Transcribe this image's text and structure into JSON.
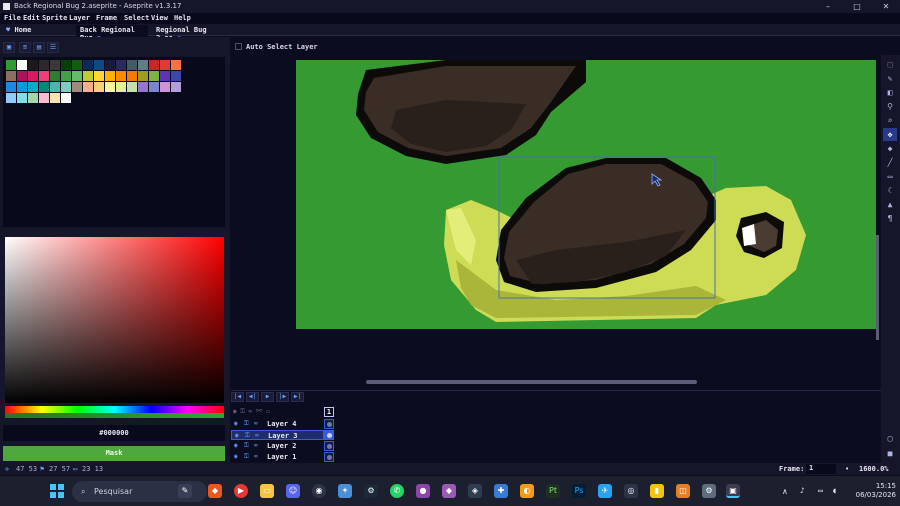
{
  "window": {
    "title": "Back Regional Bug 2.aseprite - Aseprite v1.3.17",
    "controls": [
      "–",
      "□",
      "✕"
    ]
  },
  "menu": [
    "File",
    "Edit",
    "Sprite",
    "Layer",
    "Frame",
    "Select",
    "View",
    "Help"
  ],
  "tabs": [
    {
      "label": "Home",
      "icon": "heart-icon"
    },
    {
      "label": "Back Regional Bug",
      "icon": "dot-icon"
    },
    {
      "label": "Regional Bug 2.as",
      "icon": "dot-outline-icon"
    }
  ],
  "editor": {
    "auto_select_label": "Auto Select Layer",
    "canvas_bg": "#359a31"
  },
  "palette": {
    "colors": [
      "#2e9b2e",
      "#ffffff",
      "#1a1a1a",
      "#2a2a2a",
      "#3a3a3a",
      "#0d3d0d",
      "#155a15",
      "#0b2a5a",
      "#0e4a8a",
      "#1a1a40",
      "#2a2a60",
      "#455a64",
      "#607d8b",
      "#c62828",
      "#e53935",
      "#ff7043",
      "#8d6e63",
      "#ad1457",
      "#d81b60",
      "#ec407a",
      "#2e7d32",
      "#43a047",
      "#66bb6a",
      "#c0ca33",
      "#fdd835",
      "#ffb300",
      "#fb8c00",
      "#f57c00",
      "#9e9d24",
      "#7cb342",
      "#5e35b1",
      "#3949ab",
      "#1e88e5",
      "#039be5",
      "#00acc1",
      "#00897b",
      "#4db6ac",
      "#80cbc4",
      "#a1887f",
      "#ffab91",
      "#ffcc80",
      "#fff59d",
      "#e6ee9c",
      "#c5e1a5",
      "#9575cd",
      "#7986cb",
      "#ce93d8",
      "#b39ddb",
      "#90caf9",
      "#80deea",
      "#a5d6a7",
      "#f8bbd0",
      "#ffe0b2",
      "#ffffff"
    ],
    "hex_value": "#000000",
    "mask_label": "Mask"
  },
  "timeline": {
    "layers": [
      {
        "name": "Layer 4"
      },
      {
        "name": "Layer 3",
        "selected": true
      },
      {
        "name": "Layer 2"
      },
      {
        "name": "Layer 1"
      }
    ],
    "frame_header": "1"
  },
  "statusbar": {
    "cursor": "47 53",
    "flag": "27 57",
    "size": "23 13",
    "frame_label": "Frame:",
    "frame_value": "1",
    "zoom": "1600.0%"
  },
  "taskbar": {
    "search_placeholder": "Pesquisar",
    "time": "15:15",
    "date": "06/03/2026"
  }
}
